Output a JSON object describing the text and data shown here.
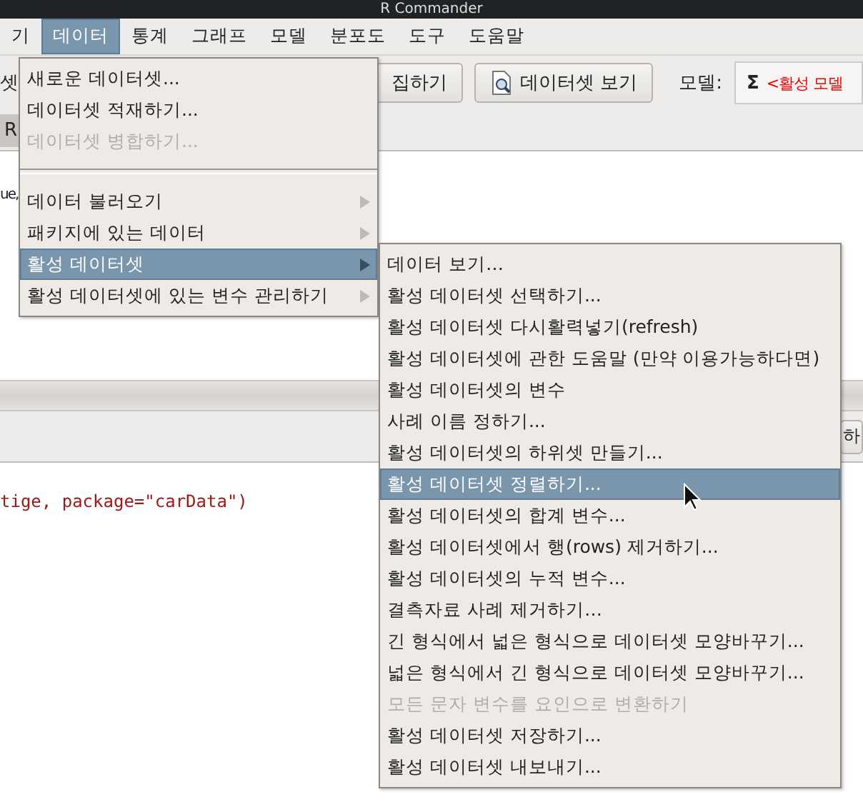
{
  "window": {
    "title": "R Commander"
  },
  "menu_bar": [
    {
      "label": "기",
      "selected": false
    },
    {
      "label": "데이터",
      "selected": true
    },
    {
      "label": "통계",
      "selected": false
    },
    {
      "label": "그래프",
      "selected": false
    },
    {
      "label": "모델",
      "selected": false
    },
    {
      "label": "분포도",
      "selected": false
    },
    {
      "label": "도구",
      "selected": false
    },
    {
      "label": "도움말",
      "selected": false
    }
  ],
  "toolbar": {
    "left_label": "셋",
    "edit_button": "집하기",
    "view_button": "데이터셋 보기",
    "model_label": "모델:",
    "model_sigma": "Σ",
    "model_value": "<활성 모델"
  },
  "script_tab": "R",
  "script_text": "ue,",
  "submit_button": "하",
  "output_text": "tige, package=\"carData\")",
  "data_menu": [
    {
      "kind": "item",
      "label": "새로운 데이터셋...",
      "disabled": false,
      "selected": false,
      "submenu": false
    },
    {
      "kind": "item",
      "label": "데이터셋 적재하기...",
      "disabled": false,
      "selected": false,
      "submenu": false
    },
    {
      "kind": "item",
      "label": "데이터셋 병합하기...",
      "disabled": true,
      "selected": false,
      "submenu": false
    },
    {
      "kind": "separator"
    },
    {
      "kind": "item",
      "label": "데이터 불러오기",
      "disabled": false,
      "selected": false,
      "submenu": true
    },
    {
      "kind": "item",
      "label": "패키지에 있는 데이터",
      "disabled": false,
      "selected": false,
      "submenu": true
    },
    {
      "kind": "item",
      "label": "활성 데이터셋",
      "disabled": false,
      "selected": true,
      "submenu": true
    },
    {
      "kind": "item",
      "label": "활성 데이터셋에 있는 변수 관리하기",
      "disabled": false,
      "selected": false,
      "submenu": true
    }
  ],
  "active_dataset_menu": [
    {
      "label": "데이터 보기…",
      "disabled": false,
      "selected": false
    },
    {
      "label": "활성 데이터셋 선택하기...",
      "disabled": false,
      "selected": false
    },
    {
      "label": "활성 데이터셋 다시활력넣기(refresh)",
      "disabled": false,
      "selected": false
    },
    {
      "label": "활성 데이터셋에 관한 도움말 (만약 이용가능하다면)",
      "disabled": false,
      "selected": false
    },
    {
      "label": "활성 데이터셋의 변수",
      "disabled": false,
      "selected": false
    },
    {
      "label": "사례 이름 정하기...",
      "disabled": false,
      "selected": false
    },
    {
      "label": "활성 데이터셋의 하위셋 만들기...",
      "disabled": false,
      "selected": false
    },
    {
      "label": "활성 데이터셋 정렬하기...",
      "disabled": false,
      "selected": true
    },
    {
      "label": "활성 데이터셋의 합계 변수...",
      "disabled": false,
      "selected": false
    },
    {
      "label": "활성 데이터셋에서 행(rows) 제거하기...",
      "disabled": false,
      "selected": false
    },
    {
      "label": "활성 데이터셋의 누적 변수...",
      "disabled": false,
      "selected": false
    },
    {
      "label": "결측자료 사례 제거하기…",
      "disabled": false,
      "selected": false
    },
    {
      "label": "긴 형식에서 넓은 형식으로 데이터셋 모양바꾸기...",
      "disabled": false,
      "selected": false
    },
    {
      "label": "넓은 형식에서 긴 형식으로 데이터셋 모양바꾸기...",
      "disabled": false,
      "selected": false
    },
    {
      "label": "모든 문자 변수를 요인으로 변환하기",
      "disabled": true,
      "selected": false
    },
    {
      "label": "활성 데이터셋 저장하기...",
      "disabled": false,
      "selected": false
    },
    {
      "label": "활성 데이터셋 내보내기...",
      "disabled": false,
      "selected": false
    }
  ]
}
